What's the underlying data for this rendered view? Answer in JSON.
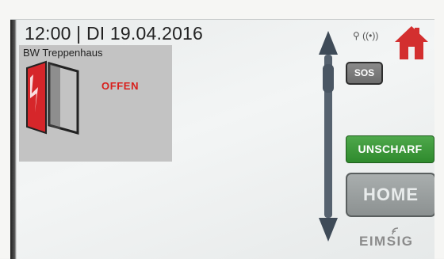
{
  "header": {
    "time": "12:00",
    "separator": "|",
    "date": "DI 19.04.2016"
  },
  "door_tile": {
    "title": "BW Treppenhaus",
    "status": "OFFEN",
    "icon": "open-door-icon",
    "status_color": "#d8201d"
  },
  "status_bar": {
    "usb_icon": "usb-icon",
    "wireless_icon": "wireless-icon"
  },
  "home_icon": {
    "icon": "house-icon",
    "color": "#d32f2f"
  },
  "buttons": {
    "sos_label": "SOS",
    "unscharf_label": "UNSCHARF",
    "unscharf_color": "#3d9a3a",
    "home_label": "HOME"
  },
  "scroll": {
    "up_icon": "scroll-up-arrow-icon",
    "down_icon": "scroll-down-arrow-icon"
  },
  "brand": {
    "name": "EIMSIG"
  }
}
